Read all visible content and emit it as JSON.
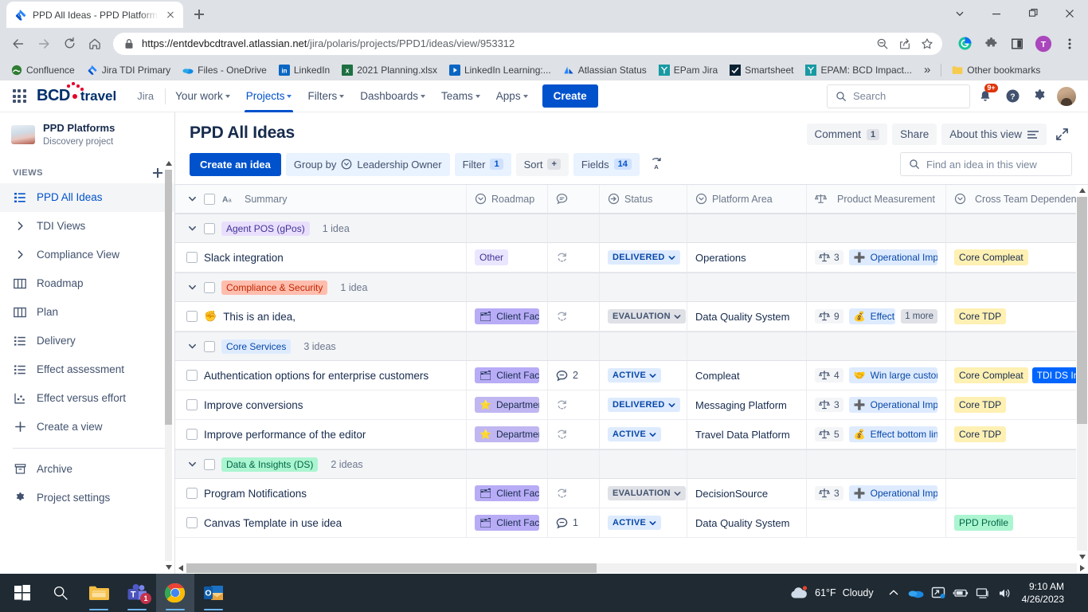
{
  "browser": {
    "tab": {
      "title": "PPD All Ideas - PPD Platforms - Ji",
      "favicon": "jira-icon"
    },
    "url_domain": "https://entdevbcdtravel.atlassian.net",
    "url_path": "/jira/polaris/projects/PPD1/ideas/view/953312",
    "new_tab_label": "+",
    "bookmarks": [
      {
        "label": "Confluence",
        "icon": "confluence-icon"
      },
      {
        "label": "Jira TDI Primary",
        "icon": "jira-icon"
      },
      {
        "label": "Files - OneDrive",
        "icon": "onedrive-icon"
      },
      {
        "label": "LinkedIn",
        "icon": "linkedin-icon"
      },
      {
        "label": "2021 Planning.xlsx",
        "icon": "excel-icon"
      },
      {
        "label": "LinkedIn Learning:...",
        "icon": "linkedin-learning-icon"
      },
      {
        "label": "Atlassian Status",
        "icon": "atlassian-icon"
      },
      {
        "label": "EPam Jira",
        "icon": "epam-jira-icon"
      },
      {
        "label": "Smartsheet",
        "icon": "smartsheet-icon"
      },
      {
        "label": "EPAM: BCD Impact...",
        "icon": "epam-icon"
      }
    ],
    "overflow_label": "»",
    "other_bookmarks": "Other bookmarks"
  },
  "jira_nav": {
    "logo_bcd": "BCD",
    "logo_travel": "travel",
    "product": "Jira",
    "items": [
      {
        "label": "Your work",
        "active": false
      },
      {
        "label": "Projects",
        "active": true
      },
      {
        "label": "Filters",
        "active": false
      },
      {
        "label": "Dashboards",
        "active": false
      },
      {
        "label": "Teams",
        "active": false
      },
      {
        "label": "Apps",
        "active": false
      }
    ],
    "create_label": "Create",
    "search_placeholder": "Search",
    "notification_badge": "9+"
  },
  "sidebar": {
    "project_name": "PPD Platforms",
    "project_type": "Discovery project",
    "section_label": "VIEWS",
    "items": [
      {
        "label": "PPD All Ideas",
        "icon": "list-view-icon",
        "selected": true
      },
      {
        "label": "TDI Views",
        "icon": "chevron-right-icon",
        "selected": false
      },
      {
        "label": "Compliance View",
        "icon": "chevron-right-icon",
        "selected": false
      },
      {
        "label": "Roadmap",
        "icon": "board-icon",
        "selected": false
      },
      {
        "label": "Plan",
        "icon": "board-icon",
        "selected": false
      },
      {
        "label": "Delivery",
        "icon": "list-view-icon",
        "selected": false
      },
      {
        "label": "Effect assessment",
        "icon": "list-view-icon",
        "selected": false
      },
      {
        "label": "Effect versus effort",
        "icon": "scatter-chart-icon",
        "selected": false
      },
      {
        "label": "Create a view",
        "icon": "plus-icon",
        "selected": false
      }
    ],
    "footer_items": [
      {
        "label": "Archive",
        "icon": "archive-icon"
      },
      {
        "label": "Project settings",
        "icon": "gear-icon"
      }
    ]
  },
  "main": {
    "title": "PPD All Ideas",
    "header_actions": {
      "comment_label": "Comment",
      "comment_count": "1",
      "share_label": "Share",
      "about_label": "About this view",
      "expand_icon": "expand-icon"
    },
    "toolbar": {
      "create_idea": "Create an idea",
      "group_by_label": "Group by",
      "group_by_value": "Leadership Owner",
      "filter_label": "Filter",
      "filter_count": "1",
      "sort_label": "Sort",
      "sort_plus": "+",
      "fields_label": "Fields",
      "fields_count": "14",
      "autosort_icon": "auto-sort-icon"
    },
    "find_placeholder": "Find an idea in this view"
  },
  "table": {
    "columns": [
      {
        "key": "summary",
        "label": "Summary",
        "icon": "text-field-icon"
      },
      {
        "key": "roadmap",
        "label": "Roadmap",
        "icon": "select-field-icon"
      },
      {
        "key": "comments",
        "label": "",
        "icon": "comment-field-icon"
      },
      {
        "key": "status",
        "label": "Status",
        "icon": "status-field-icon"
      },
      {
        "key": "platform_area",
        "label": "Platform Area",
        "icon": "select-field-icon"
      },
      {
        "key": "product_measurement",
        "label": "Product Measurement",
        "icon": "weight-field-icon"
      },
      {
        "key": "cross_team_dependency",
        "label": "Cross Team Dependency",
        "icon": "select-field-icon"
      }
    ],
    "groups": [
      {
        "name": "Agent POS (gPos)",
        "tag_bg": "#e9dffc",
        "tag_fg": "#403294",
        "count": "1 idea",
        "rows": [
          {
            "summary": "Slack integration",
            "emoji": "",
            "roadmap": {
              "label": "Other",
              "bg": "#eae6ff",
              "fg": "#403294",
              "emoji": ""
            },
            "comments": "",
            "status": {
              "label": "DELIVERED",
              "bg": "#deebff",
              "fg": "#0747a6"
            },
            "platform_area": "Operations",
            "measure_score": "3",
            "measure": {
              "label": "Operational Impro",
              "bg": "#deebff",
              "fg": "#0747a6",
              "emoji": "➕",
              "more": ""
            },
            "dependencies": [
              {
                "label": "Core Compleat",
                "bg": "#fff0b3",
                "fg": "#172b4d"
              }
            ]
          }
        ]
      },
      {
        "name": "Compliance & Security",
        "tag_bg": "#ffbdad",
        "tag_fg": "#bf2600",
        "count": "1 idea",
        "rows": [
          {
            "summary": "This is an idea,",
            "emoji": "✊",
            "roadmap": {
              "label": "Client Facing",
              "bg": "#b8acf6",
              "fg": "#172b4d",
              "emoji": "🗂"
            },
            "comments": "",
            "status": {
              "label": "EVALUATION",
              "bg": "#dfe1e6",
              "fg": "#42526e"
            },
            "platform_area": "Data Quality System",
            "measure_score": "9",
            "measure": {
              "label": "Effect bot",
              "bg": "#deebff",
              "fg": "#0747a6",
              "emoji": "💰",
              "more": "1 more"
            },
            "dependencies": [
              {
                "label": "Core TDP",
                "bg": "#fff0b3",
                "fg": "#172b4d"
              }
            ]
          }
        ]
      },
      {
        "name": "Core Services",
        "tag_bg": "#deebff",
        "tag_fg": "#0747a6",
        "count": "3 ideas",
        "rows": [
          {
            "summary": "Authentication options for enterprise customers",
            "emoji": "",
            "roadmap": {
              "label": "Client Facing",
              "bg": "#b8acf6",
              "fg": "#172b4d",
              "emoji": "🗂"
            },
            "comments": "2",
            "status": {
              "label": "ACTIVE",
              "bg": "#deebff",
              "fg": "#0747a6"
            },
            "platform_area": "Compleat",
            "measure_score": "4",
            "measure": {
              "label": "Win large custome",
              "bg": "#deebff",
              "fg": "#0747a6",
              "emoji": "🤝",
              "more": ""
            },
            "dependencies": [
              {
                "label": "Core Compleat",
                "bg": "#fff0b3",
                "fg": "#172b4d"
              },
              {
                "label": "TDI DS In",
                "bg": "#0065ff",
                "fg": "#ffffff"
              }
            ]
          },
          {
            "summary": "Improve conversions",
            "emoji": "",
            "roadmap": {
              "label": "Department",
              "bg": "#c0b6f2",
              "fg": "#172b4d",
              "emoji": "⭐"
            },
            "comments": "",
            "status": {
              "label": "DELIVERED",
              "bg": "#deebff",
              "fg": "#0747a6"
            },
            "platform_area": "Messaging Platform",
            "measure_score": "3",
            "measure": {
              "label": "Operational Impro",
              "bg": "#deebff",
              "fg": "#0747a6",
              "emoji": "➕",
              "more": ""
            },
            "dependencies": [
              {
                "label": "Core TDP",
                "bg": "#fff0b3",
                "fg": "#172b4d"
              }
            ]
          },
          {
            "summary": "Improve performance of the editor",
            "emoji": "",
            "roadmap": {
              "label": "Department",
              "bg": "#c0b6f2",
              "fg": "#172b4d",
              "emoji": "⭐"
            },
            "comments": "",
            "status": {
              "label": "ACTIVE",
              "bg": "#deebff",
              "fg": "#0747a6"
            },
            "platform_area": "Travel Data Platform",
            "measure_score": "5",
            "measure": {
              "label": "Effect bottom line",
              "bg": "#deebff",
              "fg": "#0747a6",
              "emoji": "💰",
              "more": ""
            },
            "dependencies": [
              {
                "label": "Core TDP",
                "bg": "#fff0b3",
                "fg": "#172b4d"
              }
            ]
          }
        ]
      },
      {
        "name": "Data & Insights (DS)",
        "tag_bg": "#abf5d1",
        "tag_fg": "#006644",
        "count": "2 ideas",
        "rows": [
          {
            "summary": "Program Notifications",
            "emoji": "",
            "roadmap": {
              "label": "Client Facing",
              "bg": "#b8acf6",
              "fg": "#172b4d",
              "emoji": "🗂"
            },
            "comments": "",
            "status": {
              "label": "EVALUATION",
              "bg": "#dfe1e6",
              "fg": "#42526e"
            },
            "platform_area": "DecisionSource",
            "measure_score": "3",
            "measure": {
              "label": "Operational Impro",
              "bg": "#deebff",
              "fg": "#0747a6",
              "emoji": "➕",
              "more": ""
            },
            "dependencies": []
          },
          {
            "summary": "Canvas Template in use idea",
            "emoji": "",
            "roadmap": {
              "label": "Client Facing",
              "bg": "#b8acf6",
              "fg": "#172b4d",
              "emoji": "🗂"
            },
            "comments": "1",
            "status": {
              "label": "ACTIVE",
              "bg": "#deebff",
              "fg": "#0747a6"
            },
            "platform_area": "Data Quality System",
            "measure_score": "",
            "measure": null,
            "dependencies": [
              {
                "label": "PPD Profile",
                "bg": "#abf5d1",
                "fg": "#006644"
              }
            ]
          }
        ]
      }
    ]
  },
  "taskbar": {
    "items": [
      {
        "name": "start-button",
        "icon": "windows-icon"
      },
      {
        "name": "search-button",
        "icon": "search-icon"
      },
      {
        "name": "file-explorer",
        "icon": "folder-icon"
      },
      {
        "name": "teams",
        "icon": "teams-icon",
        "badge": "1"
      },
      {
        "name": "chrome",
        "icon": "chrome-icon"
      },
      {
        "name": "outlook",
        "icon": "outlook-icon"
      }
    ],
    "weather_temp": "61°F",
    "weather_cond": "Cloudy",
    "time": "9:10 AM",
    "date": "4/26/2023"
  }
}
